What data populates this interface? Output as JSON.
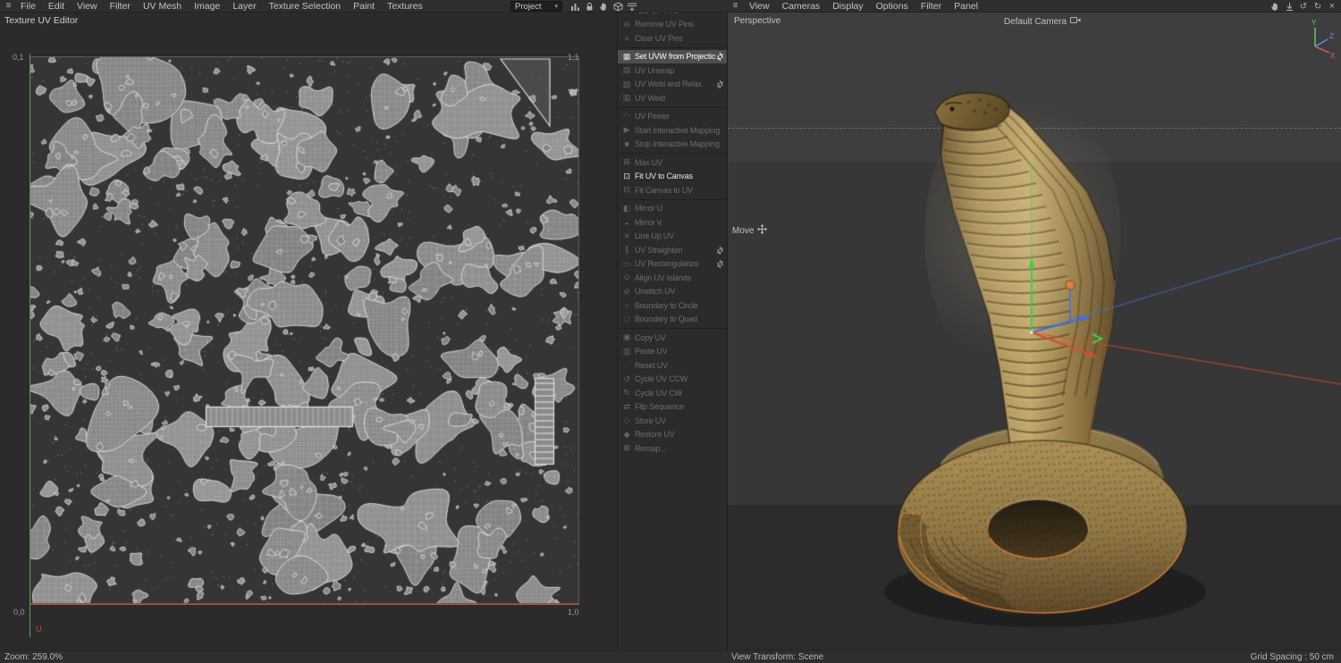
{
  "colors": {
    "axis_green": "#3fcf4a",
    "axis_red": "#e0492e",
    "axis_blue": "#3f6fe0",
    "selection_orange": "#e5823a",
    "uv_v_axis_green": "#46aa46",
    "uv_u_axis_red": "#cd4b2d",
    "snake_base": "#b39a60"
  },
  "top_menubar": {
    "left_items": [
      "File",
      "Edit",
      "View",
      "Filter",
      "UV Mesh",
      "Image",
      "Layer",
      "Texture Selection",
      "Paint",
      "Textures"
    ],
    "project_selector_value": "Project",
    "left_icon_names": [
      "chart-icon",
      "lock-icon",
      "pan-hand-icon",
      "cube-icon",
      "layer-menu-icon"
    ]
  },
  "uv_editor": {
    "title": "Texture UV Editor",
    "corner_labels": {
      "top_left": "0,1",
      "top_right": "1,1",
      "bottom_left": "0,0",
      "bottom_right": "1,0"
    },
    "u_axis_label": "U",
    "zoom_status": "Zoom: 259.0%"
  },
  "uv_commands": {
    "groups": [
      {
        "items": [
          {
            "label": "Add UV Pins",
            "enabled": false,
            "highlighted": false,
            "gear": false,
            "icon": "add-pin-icon",
            "glyph": "⊕"
          },
          {
            "label": "Remove UV Pins",
            "enabled": false,
            "highlighted": false,
            "gear": false,
            "icon": "remove-pin-icon",
            "glyph": "⊖"
          },
          {
            "label": "Clear UV Pins",
            "enabled": false,
            "highlighted": false,
            "gear": false,
            "icon": "clear-pins-icon",
            "glyph": "×"
          }
        ]
      },
      {
        "items": [
          {
            "label": "Set UVW from Projection",
            "enabled": true,
            "highlighted": true,
            "gear": true,
            "icon": "set-uvw-projection-icon",
            "glyph": "▦"
          },
          {
            "label": "UV Unwrap",
            "enabled": false,
            "highlighted": false,
            "gear": false,
            "icon": "uv-unwrap-icon",
            "glyph": "▤"
          },
          {
            "label": "UV Weld and Relax",
            "enabled": false,
            "highlighted": false,
            "gear": true,
            "icon": "uv-weld-relax-icon",
            "glyph": "▧"
          },
          {
            "label": "UV Weld",
            "enabled": false,
            "highlighted": false,
            "gear": false,
            "icon": "uv-weld-icon",
            "glyph": "▥"
          }
        ]
      },
      {
        "items": [
          {
            "label": "UV Peeler",
            "enabled": false,
            "highlighted": false,
            "gear": false,
            "icon": "uv-peeler-icon",
            "glyph": "◠"
          },
          {
            "label": "Start Interactive Mapping",
            "enabled": false,
            "highlighted": false,
            "gear": false,
            "icon": "start-interactive-mapping-icon",
            "glyph": "▶"
          },
          {
            "label": "Stop Interactive Mapping",
            "enabled": false,
            "highlighted": false,
            "gear": false,
            "icon": "stop-interactive-mapping-icon",
            "glyph": "■"
          }
        ]
      },
      {
        "items": [
          {
            "label": "Max UV",
            "enabled": false,
            "highlighted": false,
            "gear": false,
            "icon": "max-uv-icon",
            "glyph": "⊞"
          },
          {
            "label": "Fit UV to Canvas",
            "enabled": true,
            "highlighted": false,
            "gear": false,
            "icon": "fit-uv-to-canvas-icon",
            "glyph": "⊡"
          },
          {
            "label": "Fit Canvas to UV",
            "enabled": false,
            "highlighted": false,
            "gear": false,
            "icon": "fit-canvas-to-uv-icon",
            "glyph": "⊟"
          }
        ]
      },
      {
        "items": [
          {
            "label": "Mirror U",
            "enabled": false,
            "highlighted": false,
            "gear": false,
            "icon": "mirror-u-icon",
            "glyph": "◧"
          },
          {
            "label": "Mirror V",
            "enabled": false,
            "highlighted": false,
            "gear": false,
            "icon": "mirror-v-icon",
            "glyph": "◒"
          },
          {
            "label": "Line Up UV",
            "enabled": false,
            "highlighted": false,
            "gear": false,
            "icon": "line-up-uv-icon",
            "glyph": "≡"
          },
          {
            "label": "UV Straighten",
            "enabled": false,
            "highlighted": false,
            "gear": true,
            "icon": "uv-straighten-icon",
            "glyph": "∥"
          },
          {
            "label": "UV Rectangularize",
            "enabled": false,
            "highlighted": false,
            "gear": true,
            "icon": "uv-rectangularize-icon",
            "glyph": "▭"
          },
          {
            "label": "Align UV Islands",
            "enabled": false,
            "highlighted": false,
            "gear": false,
            "icon": "align-uv-islands-icon",
            "glyph": "⊙"
          },
          {
            "label": "Unstitch UV",
            "enabled": false,
            "highlighted": false,
            "gear": false,
            "icon": "unstitch-uv-icon",
            "glyph": "⊘"
          },
          {
            "label": "Boundary to Circle",
            "enabled": false,
            "highlighted": false,
            "gear": false,
            "icon": "boundary-to-circle-icon",
            "glyph": "○"
          },
          {
            "label": "Boundary to Quad",
            "enabled": false,
            "highlighted": false,
            "gear": false,
            "icon": "boundary-to-quad-icon",
            "glyph": "□"
          }
        ]
      },
      {
        "items": [
          {
            "label": "Copy UV",
            "enabled": false,
            "highlighted": false,
            "gear": false,
            "icon": "copy-uv-icon",
            "glyph": "▣"
          },
          {
            "label": "Paste UV",
            "enabled": false,
            "highlighted": false,
            "gear": false,
            "icon": "paste-uv-icon",
            "glyph": "▥"
          },
          {
            "label": "Reset UV",
            "enabled": false,
            "highlighted": false,
            "gear": false,
            "icon": "reset-uv-icon",
            "glyph": "◌"
          },
          {
            "label": "Cycle UV CCW",
            "enabled": false,
            "highlighted": false,
            "gear": false,
            "icon": "cycle-uv-ccw-icon",
            "glyph": "↺"
          },
          {
            "label": "Cycle UV CW",
            "enabled": false,
            "highlighted": false,
            "gear": false,
            "icon": "cycle-uv-cw-icon",
            "glyph": "↻"
          },
          {
            "label": "Flip Sequence",
            "enabled": false,
            "highlighted": false,
            "gear": false,
            "icon": "flip-sequence-icon",
            "glyph": "⇄"
          },
          {
            "label": "Store UV",
            "enabled": false,
            "highlighted": false,
            "gear": false,
            "icon": "store-uv-icon",
            "glyph": "◇"
          },
          {
            "label": "Restore UV",
            "enabled": false,
            "highlighted": false,
            "gear": false,
            "icon": "restore-uv-icon",
            "glyph": "◆"
          },
          {
            "label": "Remap...",
            "enabled": false,
            "highlighted": false,
            "gear": false,
            "icon": "remap-icon",
            "glyph": "⊠"
          }
        ]
      }
    ]
  },
  "viewport": {
    "menubar_items": [
      "View",
      "Cameras",
      "Display",
      "Options",
      "Filter",
      "Panel"
    ],
    "right_icon_names": [
      "pan-hand-icon",
      "download-icon",
      "history-icon",
      "sync-icon",
      "close-icon"
    ],
    "projection_label": "Perspective",
    "camera_label": "Default Camera",
    "tool_label": "Move",
    "status_left": "View Transform: Scene",
    "status_right": "Grid Spacing : 50 cm",
    "axis_gizmo_labels": {
      "x": "X",
      "y": "Y",
      "z": "Z"
    }
  }
}
